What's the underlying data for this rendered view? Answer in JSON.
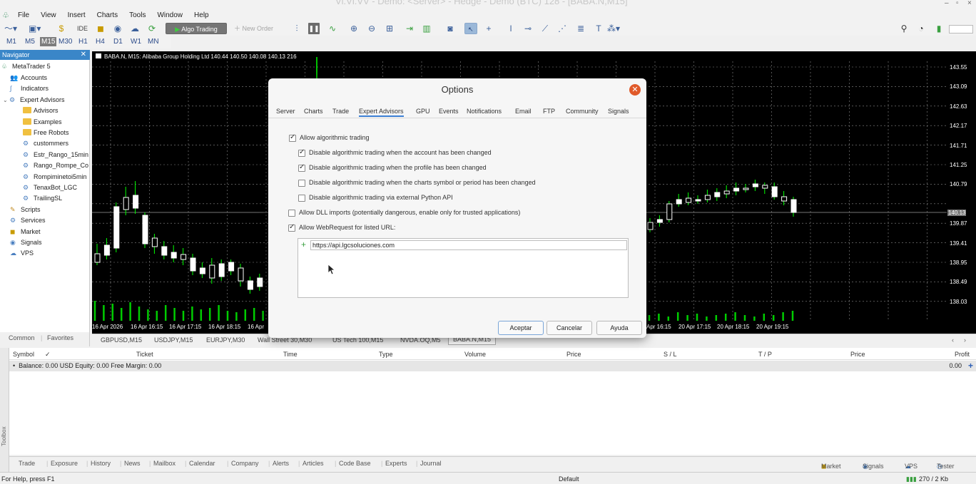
{
  "titlebar": {
    "text": "Vl.Vl.VV - Demo: <Server> - Hedge - Demo (BTC) 128 - [BABA.N,M15]"
  },
  "menu": [
    "File",
    "View",
    "Insert",
    "Charts",
    "Tools",
    "Window",
    "Help"
  ],
  "toolbar": {
    "ide_label": "IDE",
    "algo_label": "Algo Trading",
    "new_order_label": "New Order"
  },
  "timeframes": [
    "M1",
    "M5",
    "M15",
    "M30",
    "H1",
    "H4",
    "D1",
    "W1",
    "MN"
  ],
  "active_timeframe": "M15",
  "navigator": {
    "title": "Navigator",
    "items": [
      {
        "label": "MetaTrader 5",
        "icon": "mt5-logo-icon"
      },
      {
        "label": "Accounts",
        "icon": "accounts-icon"
      },
      {
        "label": "Indicators",
        "icon": "indicators-icon"
      },
      {
        "label": "Expert Advisors",
        "icon": "expert-advisors-icon"
      },
      {
        "label": "Advisors",
        "icon": "folder-icon"
      },
      {
        "label": "Examples",
        "icon": "folder-icon"
      },
      {
        "label": "Free Robots",
        "icon": "folder-icon"
      },
      {
        "label": "custommers",
        "icon": "expert-icon"
      },
      {
        "label": "Estr_Rango_15min",
        "icon": "expert-icon"
      },
      {
        "label": "Rango_Rompe_Co",
        "icon": "expert-icon"
      },
      {
        "label": "Rompiminetoi5min",
        "icon": "expert-icon"
      },
      {
        "label": "TenaxBot_LGC",
        "icon": "expert-icon"
      },
      {
        "label": "TrailingSL",
        "icon": "expert-icon"
      },
      {
        "label": "Scripts",
        "icon": "scripts-icon"
      },
      {
        "label": "Services",
        "icon": "services-icon"
      },
      {
        "label": "Market",
        "icon": "market-icon"
      },
      {
        "label": "Signals",
        "icon": "signals-icon"
      },
      {
        "label": "VPS",
        "icon": "vps-icon"
      }
    ],
    "tabs": [
      "Common",
      "Favorites"
    ]
  },
  "chart": {
    "title": "BABA.N, M15:  Alibaba Group Holding Ltd  140.44 140.50 140.08 140.13  216",
    "price_ticks": [
      "143.55",
      "143.09",
      "142.63",
      "142.17",
      "141.71",
      "141.25",
      "140.79",
      "140.13",
      "139.87",
      "139.41",
      "138.95",
      "138.49",
      "138.03"
    ],
    "current_price": "140.13",
    "time_labels": [
      "16 Apr 2026",
      "16 Apr 16:15",
      "16 Apr 17:15",
      "16 Apr 18:15",
      "16 Apr",
      "Apr 16:15",
      "20 Apr 17:15",
      "20 Apr 18:15",
      "20 Apr 19:15"
    ],
    "colors": {
      "bull": "#ffffff",
      "bear": "#ffffff",
      "wick": "#00ff00",
      "volume": "#00cc00",
      "grid": "#8a8a8a"
    }
  },
  "chart_tabs": [
    "GBPUSD,M15",
    "USDJPY,M15",
    "EURJPY,M30",
    "Wall Street 30,M30",
    "US Tech 100,M15",
    "NVDA.OQ,M5",
    "BABA.N,M15"
  ],
  "active_chart_tab": "BABA.N,M15",
  "dialog": {
    "title": "Options",
    "tabs": [
      "Server",
      "Charts",
      "Trade",
      "Expert Advisors",
      "GPU",
      "Events",
      "Notifications",
      "Email",
      "FTP",
      "Community",
      "Signals"
    ],
    "active_tab": "Expert Advisors",
    "options": [
      {
        "label": "Allow algorithmic trading",
        "checked": true
      },
      {
        "label": "Disable algorithmic trading when the account has been changed",
        "checked": true
      },
      {
        "label": "Disable algorithmic trading when the profile has been changed",
        "checked": true
      },
      {
        "label": "Disable algorithmic trading when the charts symbol or period has been changed",
        "checked": false
      },
      {
        "label": "Disable algorithmic trading via external Python API",
        "checked": false
      },
      {
        "label": "Allow DLL imports (potentially dangerous, enable only for trusted applications)",
        "checked": false
      },
      {
        "label": "Allow WebRequest for listed URL:",
        "checked": true
      }
    ],
    "url": "https://api.lgcsoluciones.com",
    "buttons": {
      "ok": "Aceptar",
      "cancel": "Cancelar",
      "help": "Ayuda"
    }
  },
  "table": {
    "columns": [
      "Symbol",
      "Ticket",
      "Time",
      "Type",
      "Volume",
      "Price",
      "S / L",
      "T / P",
      "Price",
      "Profit"
    ],
    "balance_row": "Balance: 0.00 USD  Equity: 0.00  Free Margin: 0.00",
    "profit": "0.00"
  },
  "bottom_tabs": [
    "Trade",
    "Exposure",
    "History",
    "News",
    "Mailbox",
    "Calendar",
    "Company",
    "Alerts",
    "Articles",
    "Code Base",
    "Experts",
    "Journal"
  ],
  "bottom_right": [
    "Market",
    "Signals",
    "VPS",
    "Tester"
  ],
  "toolbox_label": "Toolbox",
  "status": {
    "help": "For Help, press F1",
    "profile": "Default",
    "traffic": "270 / 2 Kb"
  }
}
